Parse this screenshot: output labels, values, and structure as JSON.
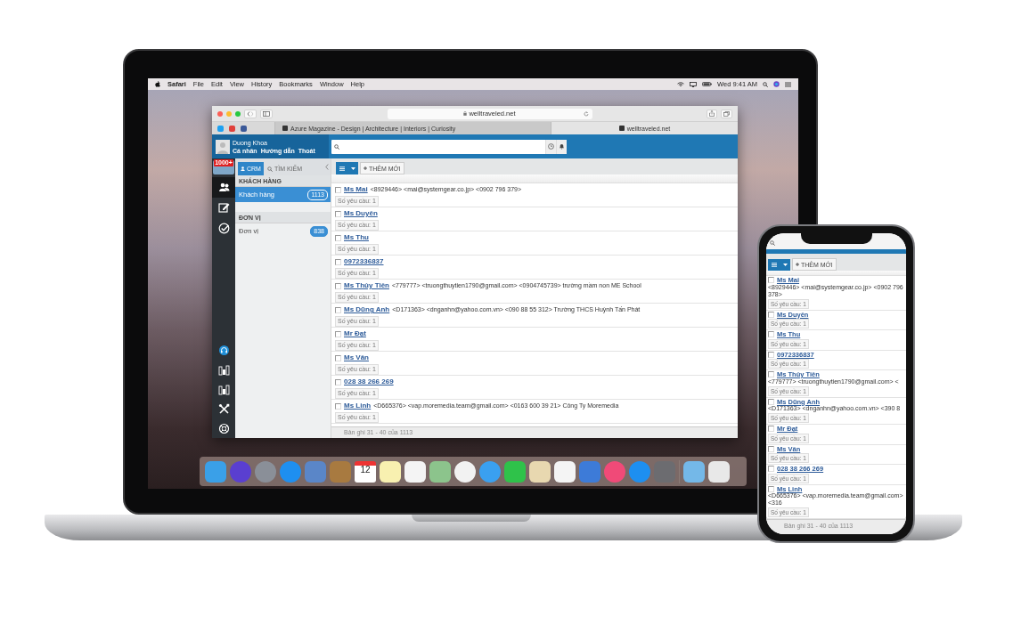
{
  "menu_bar": {
    "app": "Safari",
    "items": [
      "File",
      "Edit",
      "View",
      "History",
      "Bookmarks",
      "Window",
      "Help"
    ],
    "clock": "Wed 9:41 AM"
  },
  "browser": {
    "url": "welltraveled.net",
    "tabs": [
      {
        "label": "Azure Magazine - Design | Architecture | Interiors | Curiosity",
        "selected": false
      },
      {
        "label": "welltraveled.net",
        "selected": true
      }
    ]
  },
  "app": {
    "user": {
      "name": "Duong Khoa",
      "links": [
        "Cá nhân",
        "Hướng dẫn",
        "Thoát"
      ]
    },
    "logo_badge": "1000+",
    "rail": [
      {
        "selected": true
      },
      {
        "selected": false
      },
      {
        "selected": false
      }
    ],
    "panel_tabs": [
      {
        "label": "CRM",
        "selected": true
      },
      {
        "label": "TÌM KIẾM",
        "selected": false
      }
    ],
    "sections": [
      {
        "title": "KHÁCH HÀNG",
        "items": [
          {
            "label": "Khách hàng",
            "count": "1113",
            "selected": true
          }
        ]
      },
      {
        "title": "ĐƠN VỊ",
        "items": [
          {
            "label": "Đơn vị",
            "count": "838",
            "selected": false
          }
        ]
      }
    ],
    "add_button": "THÊM MỚI",
    "records": [
      {
        "name": "Ms Mai",
        "details": "<8929446> <mai@systemgear.co.jp> <0902 796 379>",
        "badge": "Số yêu cầu: 1",
        "checked": false
      },
      {
        "name": "Ms Duyên",
        "badge": "Số yêu cầu: 1",
        "checked": false
      },
      {
        "name": "Ms Thu",
        "badge": "Số yêu cầu: 1",
        "checked": false
      },
      {
        "name": "0972336837",
        "badge": "Số yêu cầu: 1",
        "checked": false
      },
      {
        "name": "Ms Thủy Tiên",
        "details": "<779777> <truongthuytien1790@gmail.com> <0904745739> trường mầm non ME School",
        "badge": "Số yêu cầu: 1",
        "checked": false
      },
      {
        "name": "Ms Dũng Anh",
        "details": "<D171363> <dnganhn@yahoo.com.vn> <090 88 55 312> Trường THCS Huỳnh Tấn Phát",
        "badge": "Số yêu cầu: 1",
        "checked": false
      },
      {
        "name": "Mr Đạt",
        "badge": "Số yêu cầu: 1",
        "checked": false
      },
      {
        "name": "Ms Vân",
        "badge": "Số yêu cầu: 1",
        "checked": false
      },
      {
        "name": "028 38 266 269",
        "badge": "Số yêu cầu: 1",
        "checked": false
      },
      {
        "name": "Ms Linh",
        "details": "<D665376> <vap.moremedia.team@gmail.com> <0163 600 39 21> Công Ty Moremedia",
        "badge": "Số yêu cầu: 1",
        "checked": false
      }
    ],
    "footer": "Bản ghi 31 - 40 của 1113"
  },
  "dock": {
    "calendar_date": "12"
  },
  "phone": {
    "add_button": "THÊM MỚI",
    "records": [
      {
        "name": "Ms Mai",
        "details": "<8929446> <mai@systemgear.co.jp> <0902 796 378>",
        "badge": "Số yêu cầu: 1",
        "checked": false
      },
      {
        "name": "Ms Duyên",
        "badge": "Số yêu cầu: 1",
        "checked": false
      },
      {
        "name": "Ms Thu",
        "badge": "Số yêu cầu: 1",
        "checked": false
      },
      {
        "name": "0972336837",
        "badge": "Số yêu cầu: 1",
        "checked": false
      },
      {
        "name": "Ms Thủy Tiên",
        "details": "<779777> <truongthuytien1790@gmail.com> <",
        "badge": "Số yêu cầu: 1",
        "checked": false
      },
      {
        "name": "Ms Dũng Anh",
        "details": "<D171363> <dnganhn@yahoo.com.vn> <390 8",
        "badge": "Số yêu cầu: 1",
        "checked": false
      },
      {
        "name": "Mr Đạt",
        "badge": "Số yêu cầu: 1",
        "checked": false
      },
      {
        "name": "Ms Vân",
        "badge": "Số yêu cầu: 1",
        "checked": false
      },
      {
        "name": "028 38 266 269",
        "badge": "Số yêu cầu: 1",
        "checked": false
      },
      {
        "name": "Ms Linh",
        "details": "<D665376> <vap.moremedia.team@gmail.com> <316",
        "badge": "Số yêu cầu: 1",
        "checked": false
      }
    ],
    "footer": "Bản ghi 31 - 40 của 1113"
  }
}
